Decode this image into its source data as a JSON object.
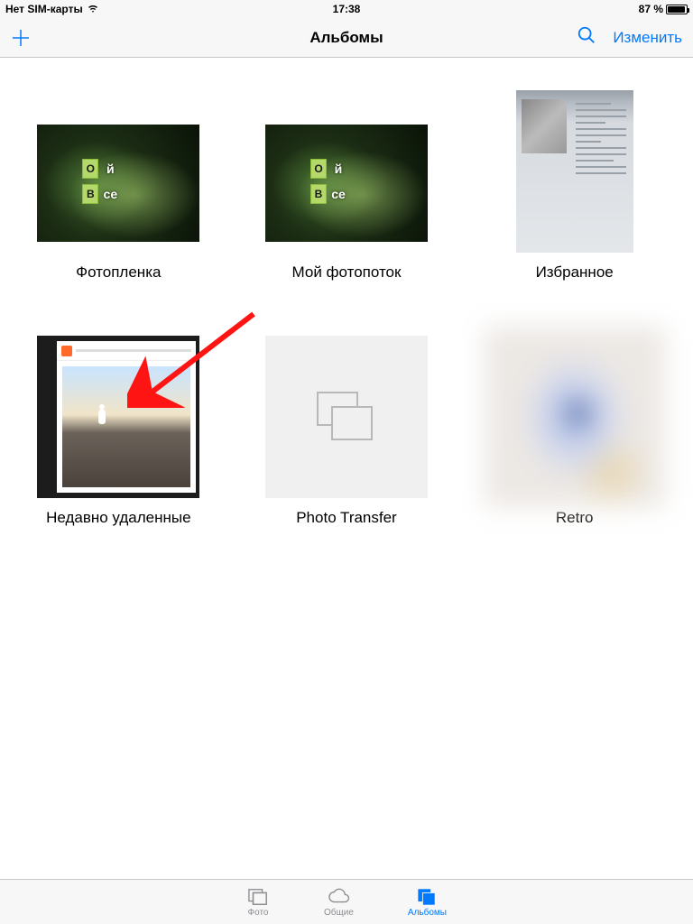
{
  "status": {
    "carrier": "Нет SIM-карты",
    "time": "17:38",
    "battery_pct": "87 %",
    "battery_fill_pct": 87
  },
  "nav": {
    "title": "Альбомы",
    "edit": "Изменить"
  },
  "albums": [
    {
      "name": "Фотопленка"
    },
    {
      "name": "Мой фотопоток"
    },
    {
      "name": "Избранное"
    },
    {
      "name": "Недавно удаленные"
    },
    {
      "name": "Photo Transfer"
    },
    {
      "name": "Retro"
    }
  ],
  "thumb_text": {
    "O": "О",
    "Y": "й",
    "B": "В",
    "se": "се"
  },
  "tabs": {
    "photos": "Фото",
    "shared": "Общие",
    "albums": "Альбомы"
  },
  "colors": {
    "tint": "#007aff"
  }
}
